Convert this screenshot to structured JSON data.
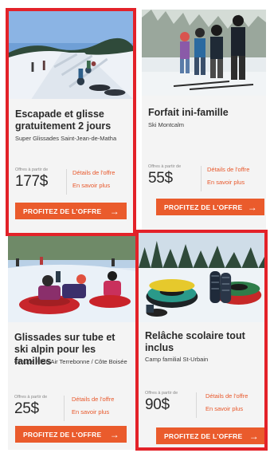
{
  "offers": [
    {
      "title": "Escapade et glisse gratuitement 2 jours",
      "organizer": "Super Glissades Saint-Jean-de-Matha",
      "offer_label": "Offres à partir de",
      "price": "177$",
      "details_link": "Détails de l'offre",
      "more_link": "En savoir plus",
      "cta": "PROFITEZ DE L'OFFRE",
      "image": "snow-tubing-slope-photo"
    },
    {
      "title": "Forfait ini-famille",
      "organizer": "Ski Montcalm",
      "offer_label": "Offres à partir de",
      "price": "55$",
      "details_link": "Détails de l'offre",
      "more_link": "En savoir plus",
      "cta": "PROFITEZ DE L'OFFRE",
      "image": "family-skiing-photo"
    },
    {
      "title": "Glissades sur tube et ski alpin pour les familles",
      "organizer": "Groupe Plein Air Terrebonne / Côte Boisée",
      "offer_label": "Offres à partir de",
      "price": "25$",
      "details_link": "Détails de l'offre",
      "more_link": "En savoir plus",
      "cta": "PROFITEZ DE L'OFFRE",
      "image": "kids-tubing-photo"
    },
    {
      "title": "Relâche scolaire tout inclus",
      "organizer": "Camp familial St-Urbain",
      "offer_label": "Offres à partir de",
      "price": "90$",
      "details_link": "Détails de l'offre",
      "more_link": "En savoir plus",
      "cta": "PROFITEZ DE L'OFFRE",
      "image": "tubes-and-snowshoes-photo"
    }
  ],
  "colors": {
    "highlight": "#e32229",
    "accent": "#ea5b2c",
    "card_bg": "#f4f4f4"
  },
  "icons": {
    "cta_arrow": "arrow-right-icon"
  }
}
